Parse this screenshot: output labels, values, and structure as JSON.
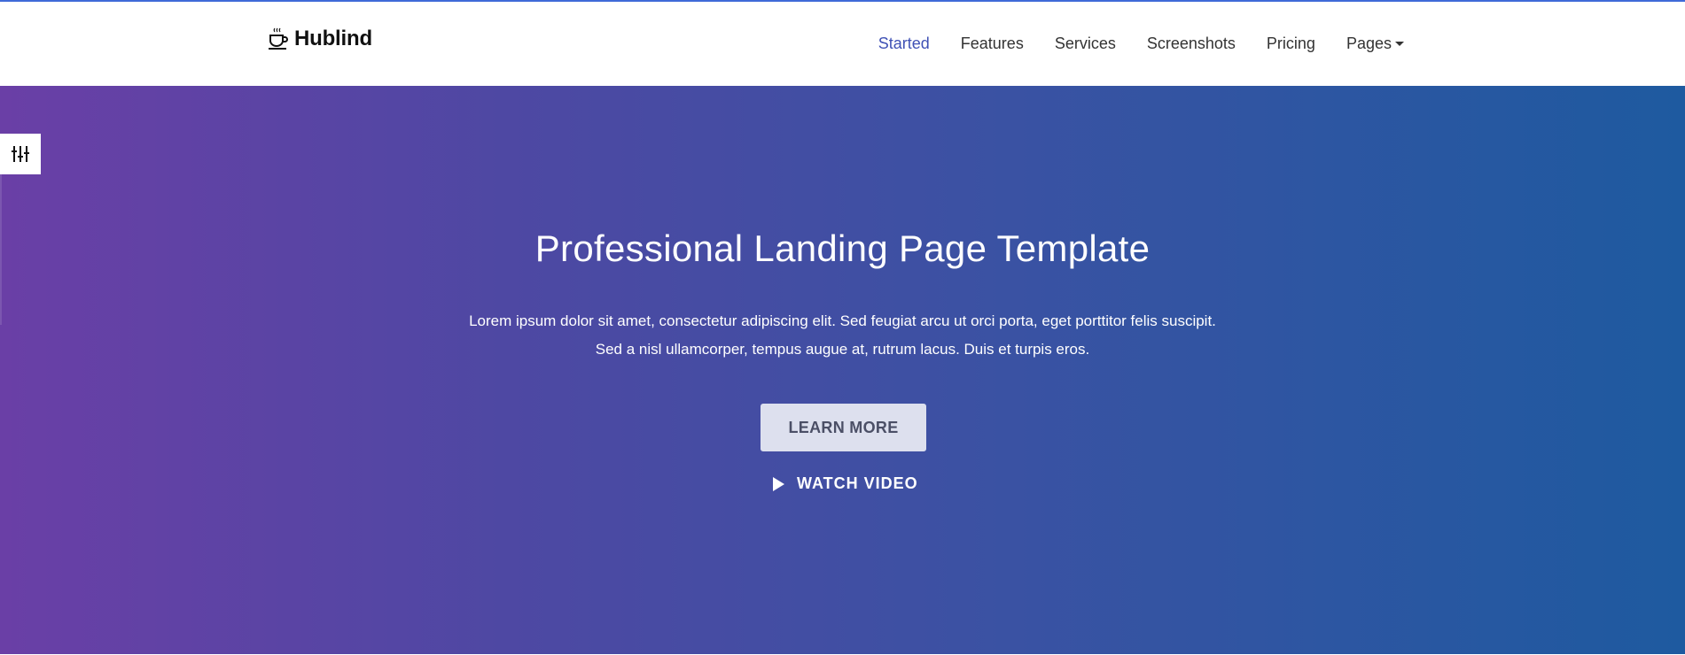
{
  "brand": {
    "name": "Hublind",
    "icon": "coffee-cup-icon"
  },
  "nav": {
    "items": [
      {
        "label": "Started",
        "active": true
      },
      {
        "label": "Features",
        "active": false
      },
      {
        "label": "Services",
        "active": false
      },
      {
        "label": "Screenshots",
        "active": false
      },
      {
        "label": "Pricing",
        "active": false
      },
      {
        "label": "Pages",
        "active": false,
        "dropdown": true
      }
    ]
  },
  "hero": {
    "title": "Professional Landing Page Template",
    "text_line1": "Lorem ipsum dolor sit amet, consectetur adipiscing elit. Sed feugiat arcu ut orci porta, eget porttitor felis suscipit.",
    "text_line2": "Sed a nisl ullamcorper, tempus augue at, rutrum lacus. Duis et turpis eros.",
    "primary_button": "LEARN MORE",
    "video_link": "WATCH VIDEO"
  },
  "settings": {
    "icon": "sliders-icon"
  },
  "colors": {
    "accent": "#3f51b5",
    "gradient_start": "#6a3fa6",
    "gradient_end": "#1e5aa0",
    "button_bg": "#dde0ee"
  }
}
